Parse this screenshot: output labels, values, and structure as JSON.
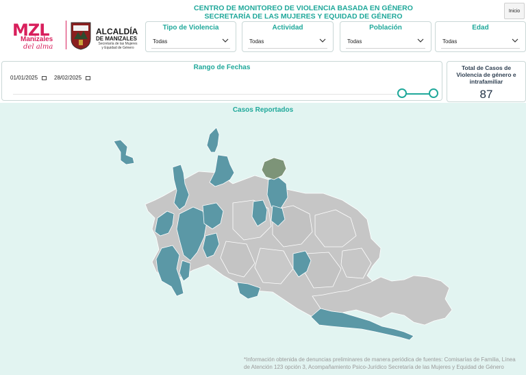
{
  "header": {
    "title_line1": "CENTRO DE MONITOREO DE VIOLENCIA BASADA EN GÉNERO",
    "title_line2": "SECRETARÍA DE LAS MUJERES Y EQUIDAD DE GÉNERO",
    "inicio_label": "Inicio"
  },
  "logos": {
    "mzl_main": "MZL",
    "mzl_sub1": "Manizales",
    "mzl_sub2": "del alma",
    "alcaldia_title": "ALCALDÍA",
    "alcaldia_sub": "DE MANIZALES",
    "alcaldia_small": "Secretaría de las Mujeres y Equidad de Género"
  },
  "filters": [
    {
      "label": "Tipo de Violencia",
      "value": "Todas"
    },
    {
      "label": "Actividad",
      "value": "Todas"
    },
    {
      "label": "Población",
      "value": "Todas"
    },
    {
      "label": "Edad",
      "value": "Todas"
    }
  ],
  "date_range": {
    "title": "Rango de Fechas",
    "start": "01/01/2025",
    "end": "28/02/2025"
  },
  "total": {
    "label": "Total de Casos de Violencia de género e intrafamiliar",
    "value": "87"
  },
  "map": {
    "title": "Casos Reportados",
    "colors": {
      "background": "#e2f4f1",
      "no_cases": "#c6c6c6",
      "with_cases": "#5b98a6",
      "highlight": "#7d9478",
      "borders": "#ffffff",
      "accent": "#1fa89a"
    }
  },
  "footnote": "*Información obtenida de denuncias preliminares de manera periódica de fuentes: Comisarías de Familia, Línea de Atención 123 opción 3, Acompañamiento Psico-Jurídico Secretaría de las Mujeres y Equidad de Género"
}
